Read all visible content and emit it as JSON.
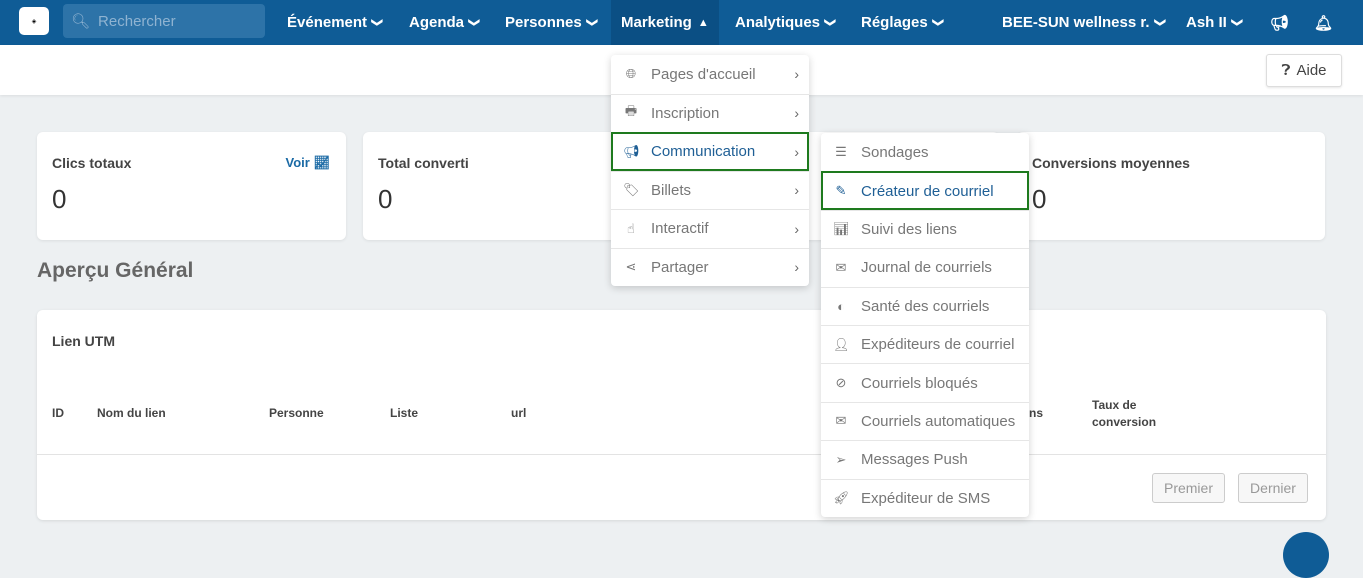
{
  "nav": {
    "logo": "HE-ma",
    "search_placeholder": "Rechercher",
    "items": [
      {
        "label": "Événement"
      },
      {
        "label": "Agenda"
      },
      {
        "label": "Personnes"
      },
      {
        "label": "Marketing"
      },
      {
        "label": "Analytiques"
      },
      {
        "label": "Réglages"
      }
    ],
    "org": "BEE-SUN wellness r.",
    "user": "Ash II"
  },
  "help": "Aide",
  "cards": [
    {
      "title": "Clics totaux",
      "value": "0",
      "link": "Voir"
    },
    {
      "title": "Total converti",
      "value": "0"
    },
    {
      "title": "",
      "value": ""
    },
    {
      "title": "Conversions moyennes",
      "value": "0"
    }
  ],
  "overview_title": "Aperçu Général",
  "table": {
    "title": "Lien UTM",
    "headers": [
      "ID",
      "Nom du lien",
      "Personne",
      "Liste",
      "url",
      "ns",
      "Taux de conversion"
    ],
    "first": "Premier",
    "last": "Dernier"
  },
  "marketing_menu": [
    {
      "label": "Pages d'accueil",
      "icon": "globe-icon"
    },
    {
      "label": "Inscription",
      "icon": "print-icon"
    },
    {
      "label": "Communication",
      "icon": "bullhorn-icon"
    },
    {
      "label": "Billets",
      "icon": "tags-icon"
    },
    {
      "label": "Interactif",
      "icon": "hand-pointer-icon"
    },
    {
      "label": "Partager",
      "icon": "share-icon"
    }
  ],
  "communication_menu": [
    {
      "label": "Sondages",
      "icon": "list-icon"
    },
    {
      "label": "Créateur de courriel",
      "icon": "edit-icon"
    },
    {
      "label": "Suivi des liens",
      "icon": "chart-icon"
    },
    {
      "label": "Journal de courriels",
      "icon": "envelope-open-icon"
    },
    {
      "label": "Santé des courriels",
      "icon": "adjust-icon"
    },
    {
      "label": "Expéditeurs de courriel",
      "icon": "user-icon"
    },
    {
      "label": "Courriels bloqués",
      "icon": "ban-icon"
    },
    {
      "label": "Courriels automatiques",
      "icon": "envelope-icon"
    },
    {
      "label": "Messages Push",
      "icon": "paper-plane-icon"
    },
    {
      "label": "Expéditeur de SMS",
      "icon": "rocket-icon"
    }
  ],
  "colors": {
    "nav": "#0f5c96",
    "highlight": "#1e7a1e",
    "link": "#1b6aa5"
  }
}
